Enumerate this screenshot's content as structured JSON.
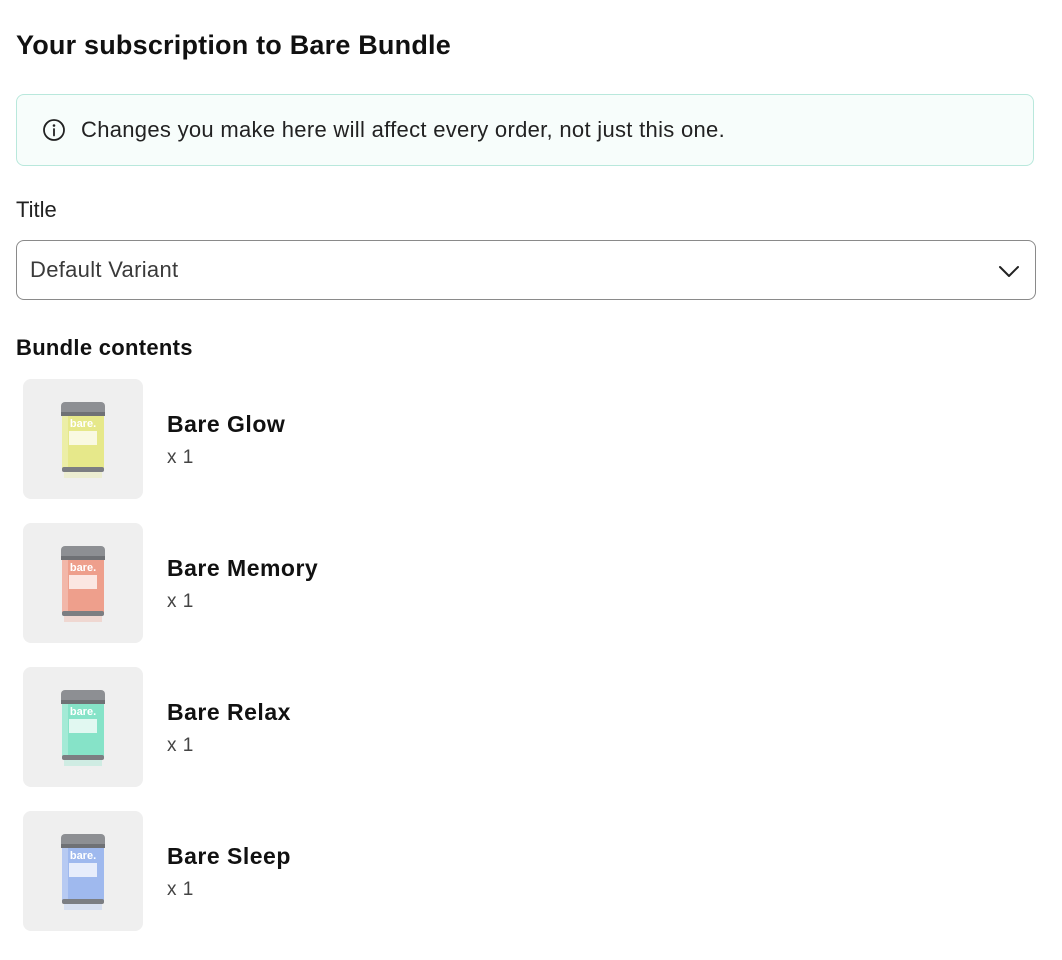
{
  "page": {
    "title": "Your subscription to Bare Bundle"
  },
  "notice": {
    "icon": "info-icon",
    "text": "Changes you make here will affect every order, not just this one."
  },
  "variant": {
    "label": "Title",
    "selected": "Default Variant",
    "icon": "chevron-down-icon"
  },
  "bundle": {
    "title": "Bundle contents",
    "items": [
      {
        "name": "Bare Glow",
        "quantity": "x 1",
        "tin_color": "#e6e88a",
        "brand": "bare."
      },
      {
        "name": "Bare Memory",
        "quantity": "x 1",
        "tin_color": "#ee9f8c",
        "brand": "bare."
      },
      {
        "name": "Bare Relax",
        "quantity": "x 1",
        "tin_color": "#86e3c8",
        "brand": "bare."
      },
      {
        "name": "Bare Sleep",
        "quantity": "x 1",
        "tin_color": "#9fb9ee",
        "brand": "bare."
      }
    ]
  },
  "colors": {
    "notice_border": "#b9e8dc",
    "select_border": "#8a8a8a",
    "thumb_background": "#efefef"
  }
}
